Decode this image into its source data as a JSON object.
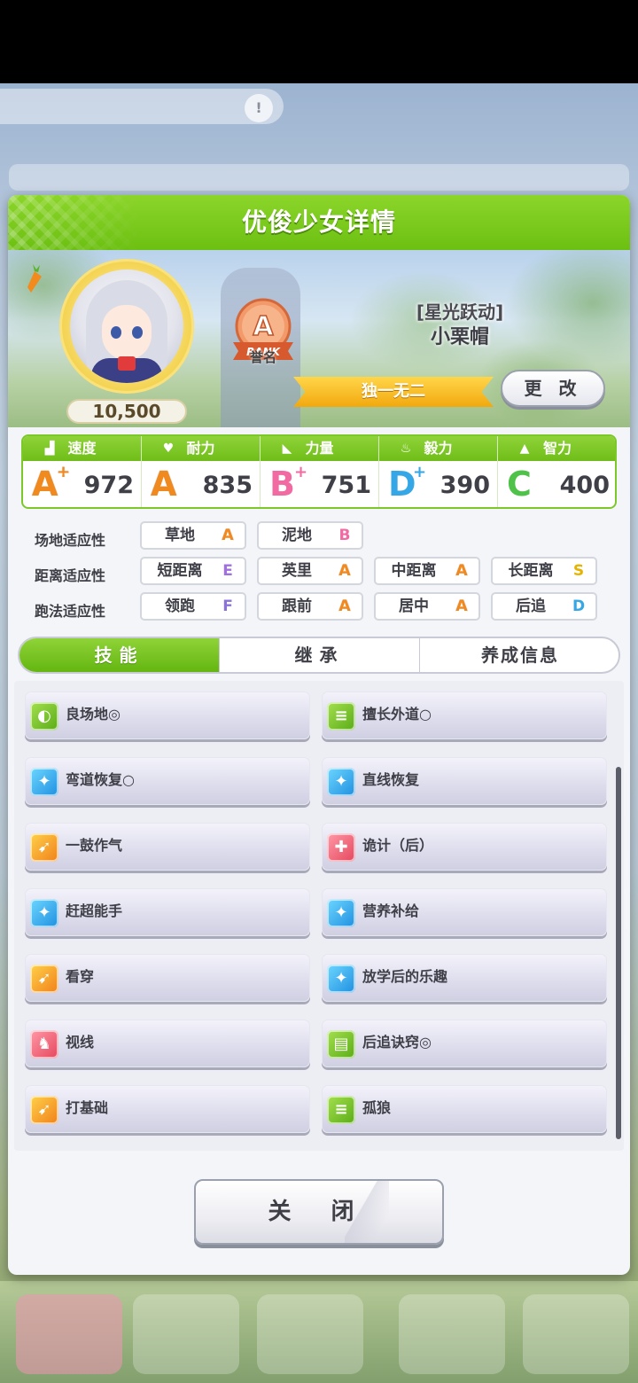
{
  "dialog": {
    "title": "优俊少女详情",
    "fans": "10,500",
    "rank": {
      "grade": "A",
      "label": "RANK",
      "caption": "誉名"
    },
    "epithet": "[星光跃动]",
    "name": "小栗帽",
    "title_banner": "独一无二",
    "change_button": "更 改"
  },
  "stats": [
    {
      "label": "速度",
      "grade": "A",
      "plus": "+",
      "value": "972",
      "icon": "shoe-icon"
    },
    {
      "label": "耐力",
      "grade": "A",
      "plus": "",
      "value": "835",
      "icon": "heart-icon"
    },
    {
      "label": "力量",
      "grade": "B",
      "plus": "+",
      "value": "751",
      "icon": "muscle-icon"
    },
    {
      "label": "毅力",
      "grade": "D",
      "plus": "+",
      "value": "390",
      "icon": "flame-icon"
    },
    {
      "label": "智力",
      "grade": "C",
      "plus": "",
      "value": "400",
      "icon": "graduation-cap-icon"
    }
  ],
  "aptitude": {
    "track": {
      "label": "场地适应性",
      "items": [
        {
          "name": "草地",
          "grade": "A"
        },
        {
          "name": "泥地",
          "grade": "B"
        }
      ]
    },
    "distance": {
      "label": "距离适应性",
      "items": [
        {
          "name": "短距离",
          "grade": "E"
        },
        {
          "name": "英里",
          "grade": "A"
        },
        {
          "name": "中距离",
          "grade": "A"
        },
        {
          "name": "长距离",
          "grade": "S"
        }
      ]
    },
    "strategy": {
      "label": "跑法适应性",
      "items": [
        {
          "name": "领跑",
          "grade": "F"
        },
        {
          "name": "跟前",
          "grade": "A"
        },
        {
          "name": "居中",
          "grade": "A"
        },
        {
          "name": "后追",
          "grade": "D"
        }
      ]
    }
  },
  "tabs": [
    "技能",
    "继承",
    "养成信息"
  ],
  "skills": [
    {
      "name": "良场地◎",
      "color": "green"
    },
    {
      "name": "擅长外道○",
      "color": "green"
    },
    {
      "name": "弯道恢复○",
      "color": "blue"
    },
    {
      "name": "直线恢复",
      "color": "blue"
    },
    {
      "name": "一鼓作气",
      "color": "orange"
    },
    {
      "name": "诡计（后）",
      "color": "red"
    },
    {
      "name": "赶超能手",
      "color": "blue"
    },
    {
      "name": "营养补给",
      "color": "blue"
    },
    {
      "name": "看穿",
      "color": "orange"
    },
    {
      "name": "放学后的乐趣",
      "color": "blue"
    },
    {
      "name": "视线",
      "color": "red"
    },
    {
      "name": "后追诀窍◎",
      "color": "green"
    },
    {
      "name": "打基础",
      "color": "orange"
    },
    {
      "name": "孤狼",
      "color": "green"
    }
  ],
  "close_button": "关 闭"
}
